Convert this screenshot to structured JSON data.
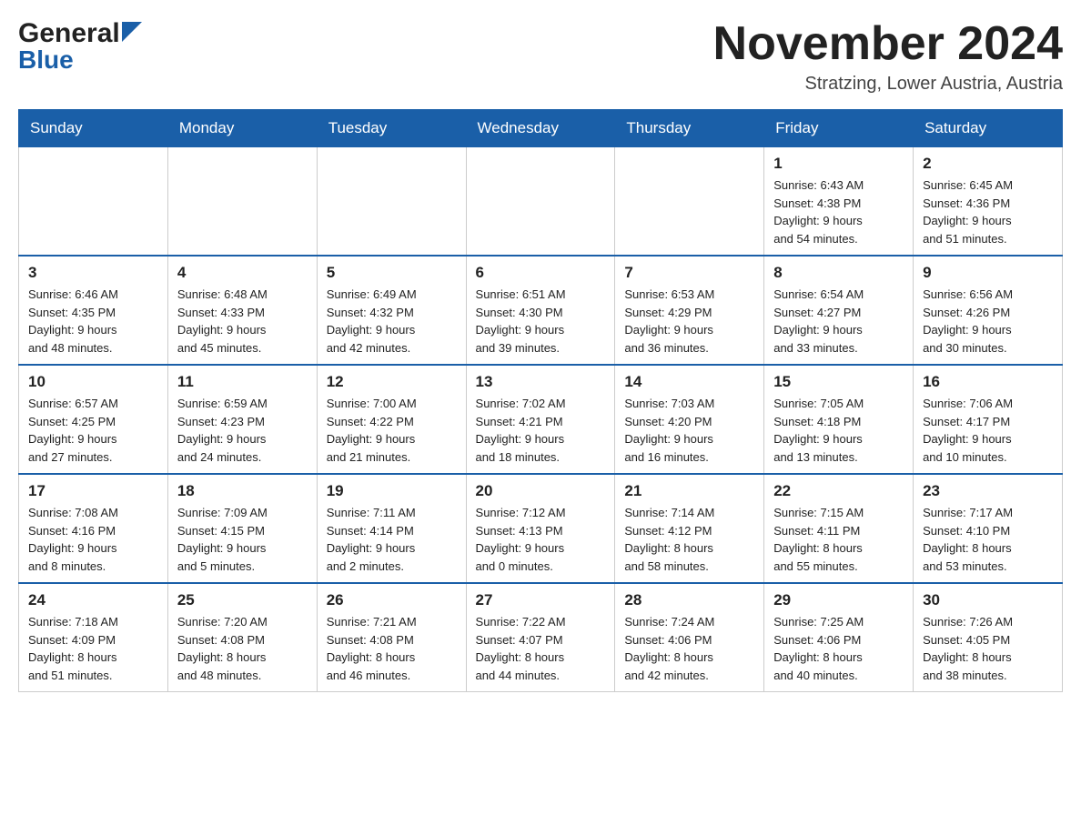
{
  "logo": {
    "general": "General",
    "blue": "Blue"
  },
  "title": {
    "month_year": "November 2024",
    "location": "Stratzing, Lower Austria, Austria"
  },
  "headers": [
    "Sunday",
    "Monday",
    "Tuesday",
    "Wednesday",
    "Thursday",
    "Friday",
    "Saturday"
  ],
  "weeks": [
    [
      {
        "day": "",
        "info": ""
      },
      {
        "day": "",
        "info": ""
      },
      {
        "day": "",
        "info": ""
      },
      {
        "day": "",
        "info": ""
      },
      {
        "day": "",
        "info": ""
      },
      {
        "day": "1",
        "info": "Sunrise: 6:43 AM\nSunset: 4:38 PM\nDaylight: 9 hours\nand 54 minutes."
      },
      {
        "day": "2",
        "info": "Sunrise: 6:45 AM\nSunset: 4:36 PM\nDaylight: 9 hours\nand 51 minutes."
      }
    ],
    [
      {
        "day": "3",
        "info": "Sunrise: 6:46 AM\nSunset: 4:35 PM\nDaylight: 9 hours\nand 48 minutes."
      },
      {
        "day": "4",
        "info": "Sunrise: 6:48 AM\nSunset: 4:33 PM\nDaylight: 9 hours\nand 45 minutes."
      },
      {
        "day": "5",
        "info": "Sunrise: 6:49 AM\nSunset: 4:32 PM\nDaylight: 9 hours\nand 42 minutes."
      },
      {
        "day": "6",
        "info": "Sunrise: 6:51 AM\nSunset: 4:30 PM\nDaylight: 9 hours\nand 39 minutes."
      },
      {
        "day": "7",
        "info": "Sunrise: 6:53 AM\nSunset: 4:29 PM\nDaylight: 9 hours\nand 36 minutes."
      },
      {
        "day": "8",
        "info": "Sunrise: 6:54 AM\nSunset: 4:27 PM\nDaylight: 9 hours\nand 33 minutes."
      },
      {
        "day": "9",
        "info": "Sunrise: 6:56 AM\nSunset: 4:26 PM\nDaylight: 9 hours\nand 30 minutes."
      }
    ],
    [
      {
        "day": "10",
        "info": "Sunrise: 6:57 AM\nSunset: 4:25 PM\nDaylight: 9 hours\nand 27 minutes."
      },
      {
        "day": "11",
        "info": "Sunrise: 6:59 AM\nSunset: 4:23 PM\nDaylight: 9 hours\nand 24 minutes."
      },
      {
        "day": "12",
        "info": "Sunrise: 7:00 AM\nSunset: 4:22 PM\nDaylight: 9 hours\nand 21 minutes."
      },
      {
        "day": "13",
        "info": "Sunrise: 7:02 AM\nSunset: 4:21 PM\nDaylight: 9 hours\nand 18 minutes."
      },
      {
        "day": "14",
        "info": "Sunrise: 7:03 AM\nSunset: 4:20 PM\nDaylight: 9 hours\nand 16 minutes."
      },
      {
        "day": "15",
        "info": "Sunrise: 7:05 AM\nSunset: 4:18 PM\nDaylight: 9 hours\nand 13 minutes."
      },
      {
        "day": "16",
        "info": "Sunrise: 7:06 AM\nSunset: 4:17 PM\nDaylight: 9 hours\nand 10 minutes."
      }
    ],
    [
      {
        "day": "17",
        "info": "Sunrise: 7:08 AM\nSunset: 4:16 PM\nDaylight: 9 hours\nand 8 minutes."
      },
      {
        "day": "18",
        "info": "Sunrise: 7:09 AM\nSunset: 4:15 PM\nDaylight: 9 hours\nand 5 minutes."
      },
      {
        "day": "19",
        "info": "Sunrise: 7:11 AM\nSunset: 4:14 PM\nDaylight: 9 hours\nand 2 minutes."
      },
      {
        "day": "20",
        "info": "Sunrise: 7:12 AM\nSunset: 4:13 PM\nDaylight: 9 hours\nand 0 minutes."
      },
      {
        "day": "21",
        "info": "Sunrise: 7:14 AM\nSunset: 4:12 PM\nDaylight: 8 hours\nand 58 minutes."
      },
      {
        "day": "22",
        "info": "Sunrise: 7:15 AM\nSunset: 4:11 PM\nDaylight: 8 hours\nand 55 minutes."
      },
      {
        "day": "23",
        "info": "Sunrise: 7:17 AM\nSunset: 4:10 PM\nDaylight: 8 hours\nand 53 minutes."
      }
    ],
    [
      {
        "day": "24",
        "info": "Sunrise: 7:18 AM\nSunset: 4:09 PM\nDaylight: 8 hours\nand 51 minutes."
      },
      {
        "day": "25",
        "info": "Sunrise: 7:20 AM\nSunset: 4:08 PM\nDaylight: 8 hours\nand 48 minutes."
      },
      {
        "day": "26",
        "info": "Sunrise: 7:21 AM\nSunset: 4:08 PM\nDaylight: 8 hours\nand 46 minutes."
      },
      {
        "day": "27",
        "info": "Sunrise: 7:22 AM\nSunset: 4:07 PM\nDaylight: 8 hours\nand 44 minutes."
      },
      {
        "day": "28",
        "info": "Sunrise: 7:24 AM\nSunset: 4:06 PM\nDaylight: 8 hours\nand 42 minutes."
      },
      {
        "day": "29",
        "info": "Sunrise: 7:25 AM\nSunset: 4:06 PM\nDaylight: 8 hours\nand 40 minutes."
      },
      {
        "day": "30",
        "info": "Sunrise: 7:26 AM\nSunset: 4:05 PM\nDaylight: 8 hours\nand 38 minutes."
      }
    ]
  ]
}
